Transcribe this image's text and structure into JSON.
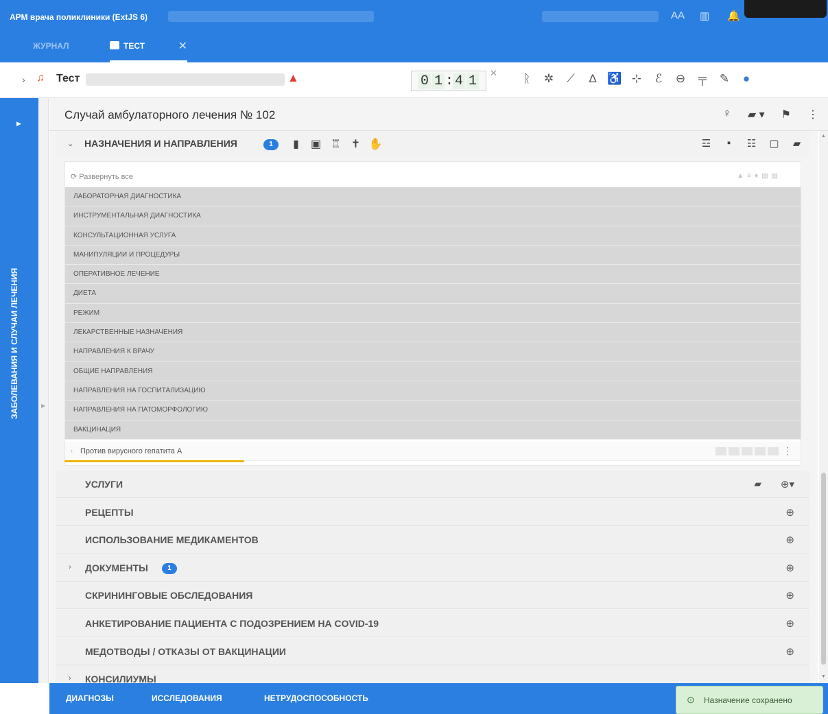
{
  "window": {
    "title": "АРМ врача поликлиники (ExtJS 6)",
    "font_toggle": "AA"
  },
  "tabs": [
    {
      "label": "Журнал",
      "active": false
    },
    {
      "label": "Тест",
      "active": true
    }
  ],
  "patient": {
    "name": "Тест",
    "timer": [
      "0",
      "1",
      "4",
      "1"
    ],
    "timer_sep": ":"
  },
  "sidebar": {
    "label": "ЗАБОЛЕВАНИЯ И СЛУЧАИ ЛЕЧЕНИЯ"
  },
  "case": {
    "title": "Случай амбулаторного лечения № 102"
  },
  "prescriptions": {
    "title": "Назначения и направления",
    "badge": "1",
    "expand_all": "Развернуть все",
    "categories": [
      "Лабораторная диагностика",
      "Инструментальная диагностика",
      "Консультационная услуга",
      "Манипуляции и процедуры",
      "Оперативное лечение",
      "Диета",
      "Режим",
      "Лекарственные назначения",
      "Направления к врачу",
      "Общие направления",
      "Направления на госпитализацию",
      "Направления на патоморфологию",
      "Вакцинация"
    ],
    "vaccination_item": "Против вирусного гепатита А"
  },
  "sections": [
    {
      "title": "Услуги",
      "badge": null,
      "expandable": false
    },
    {
      "title": "Рецепты",
      "badge": null,
      "expandable": false
    },
    {
      "title": "Использование медикаментов",
      "badge": null,
      "expandable": false
    },
    {
      "title": "Документы",
      "badge": "1",
      "expandable": true
    },
    {
      "title": "Скрининговые обследования",
      "badge": null,
      "expandable": false
    },
    {
      "title": "Анкетирование пациента с подозрением на COVID-19",
      "badge": null,
      "expandable": false
    },
    {
      "title": "Медотводы / отказы от вакцинации",
      "badge": null,
      "expandable": false
    },
    {
      "title": "Консилиумы",
      "badge": null,
      "expandable": true
    }
  ],
  "bottom_tabs": [
    "Диагнозы",
    "Исследования",
    "Нетрудоспособность"
  ],
  "toast": {
    "message": "Назначение сохранено"
  },
  "colors": {
    "primary": "#2b7fe0",
    "toast_bg": "#d9f0d6",
    "highlight": "#f0b400",
    "category_bg": "#d7d7d7"
  }
}
